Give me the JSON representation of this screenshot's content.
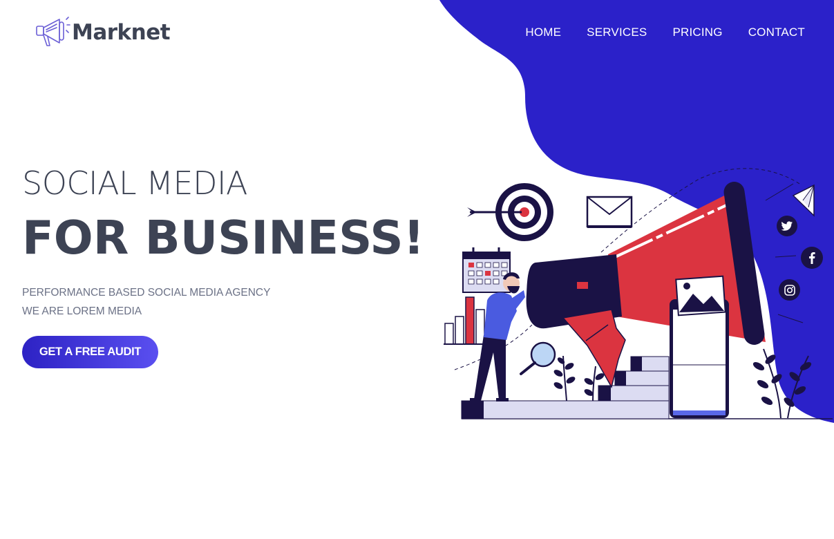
{
  "brand": {
    "name": "Marknet",
    "icon": "megaphone-icon"
  },
  "nav": {
    "items": [
      "HOME",
      "SERVICES",
      "PRICING",
      "CONTACT"
    ]
  },
  "hero": {
    "subtitle": "SOCIAL MEDIA",
    "title": "FOR BUSINESS!",
    "tagline_line1": "PERFORMANCE BASED SOCIAL MEDIA AGENCY",
    "tagline_line2": "WE ARE LOREM MEDIA",
    "cta_label": "GET A FREE AUDIT"
  },
  "social": {
    "icons": [
      "twitter-icon",
      "facebook-icon",
      "instagram-icon"
    ]
  },
  "colors": {
    "accent_blue": "#2b21c9",
    "text_dark": "#3d4354",
    "text_muted": "#6b7186",
    "megaphone_red": "#db3440",
    "navy": "#1a1245",
    "light_lavender": "#dcdcf2"
  }
}
